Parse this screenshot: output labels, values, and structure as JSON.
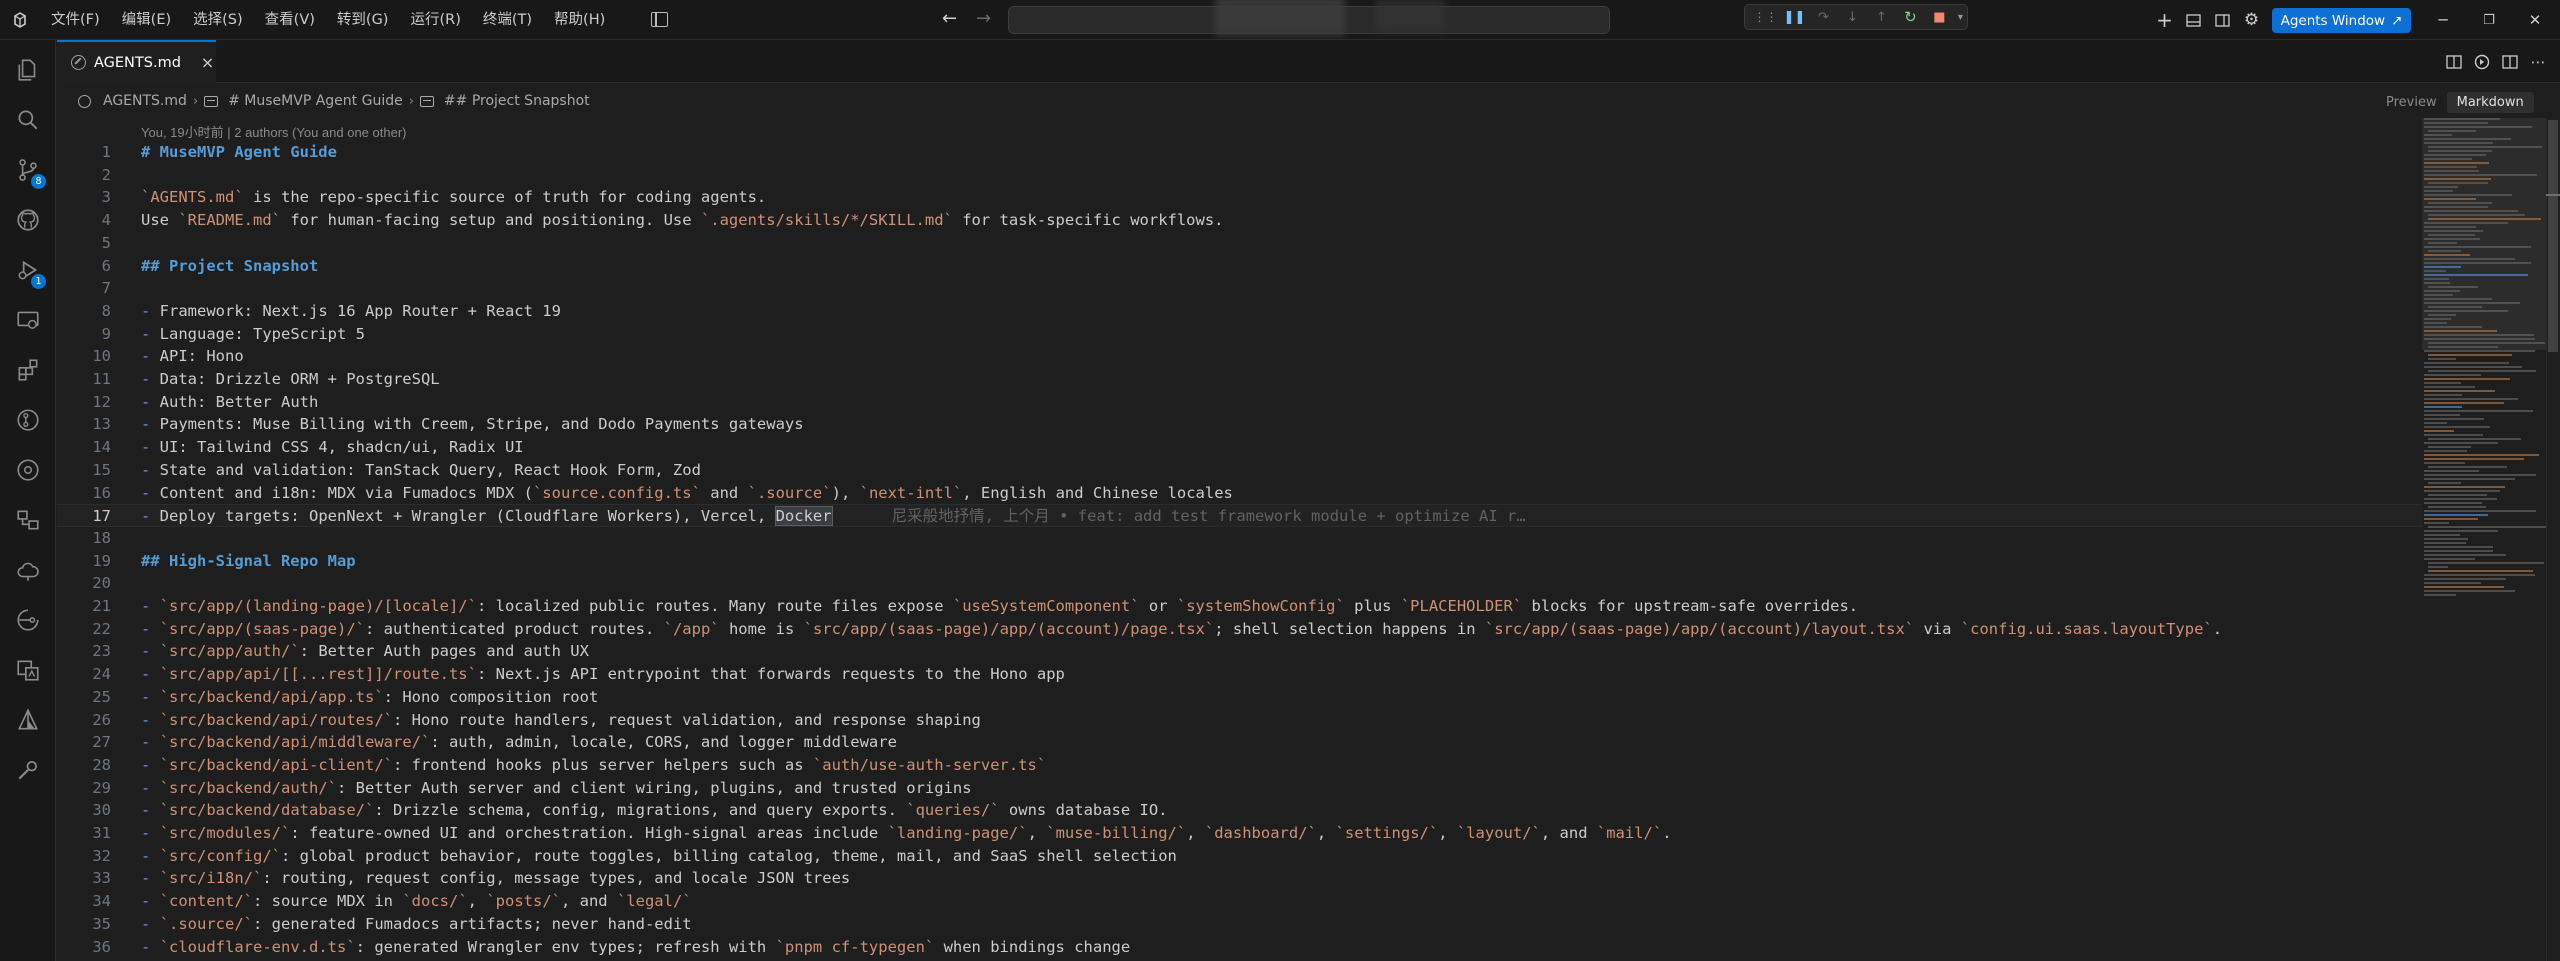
{
  "titlebar": {
    "menu": [
      "文件(F)",
      "编辑(E)",
      "选择(S)",
      "查看(V)",
      "转到(G)",
      "运行(R)",
      "终端(T)",
      "帮助(H)"
    ],
    "agents_button": "Agents Window"
  },
  "activity": {
    "scm_badge": "8",
    "debug_badge": "1"
  },
  "tab": {
    "label": "AGENTS.md",
    "close": "×"
  },
  "breadcrumb": {
    "file": "AGENTS.md",
    "heading1": "# MuseMVP Agent Guide",
    "heading2": "## Project Snapshot"
  },
  "view_switch": {
    "preview": "Preview",
    "markdown": "Markdown"
  },
  "blame": "You, 19小时前 | 2 authors (You and one other)",
  "inline_blame": "尼采般地抒情, 上个月 • feat: add test framework module + optimize AI r…",
  "editor_lines": [
    {
      "n": "1",
      "parts": [
        {
          "t": "# MuseMVP Agent Guide",
          "c": "h"
        }
      ]
    },
    {
      "n": "2",
      "parts": []
    },
    {
      "n": "3",
      "parts": [
        {
          "t": "`AGENTS.md`",
          "c": "c"
        },
        {
          "t": " is the repo-specific source of truth for coding agents.",
          "c": ""
        }
      ]
    },
    {
      "n": "4",
      "parts": [
        {
          "t": "Use ",
          "c": ""
        },
        {
          "t": "`README.md`",
          "c": "c"
        },
        {
          "t": " for human-facing setup and positioning. Use ",
          "c": ""
        },
        {
          "t": "`.agents/skills/*/SKILL.md`",
          "c": "c"
        },
        {
          "t": " for task-specific workflows.",
          "c": ""
        }
      ]
    },
    {
      "n": "5",
      "parts": []
    },
    {
      "n": "6",
      "parts": [
        {
          "t": "## Project Snapshot",
          "c": "h"
        }
      ]
    },
    {
      "n": "7",
      "parts": []
    },
    {
      "n": "8",
      "parts": [
        {
          "t": "-",
          "c": "p"
        },
        {
          "t": " Framework: Next.js 16 App Router + React 19",
          "c": ""
        }
      ]
    },
    {
      "n": "9",
      "parts": [
        {
          "t": "-",
          "c": "p"
        },
        {
          "t": " Language: TypeScript 5",
          "c": ""
        }
      ]
    },
    {
      "n": "10",
      "parts": [
        {
          "t": "-",
          "c": "p"
        },
        {
          "t": " API: Hono",
          "c": ""
        }
      ]
    },
    {
      "n": "11",
      "parts": [
        {
          "t": "-",
          "c": "p"
        },
        {
          "t": " Data: Drizzle ORM + PostgreSQL",
          "c": ""
        }
      ]
    },
    {
      "n": "12",
      "parts": [
        {
          "t": "-",
          "c": "p"
        },
        {
          "t": " Auth: Better Auth",
          "c": ""
        }
      ]
    },
    {
      "n": "13",
      "parts": [
        {
          "t": "-",
          "c": "p"
        },
        {
          "t": " Payments: Muse Billing with Creem, Stripe, and Dodo Payments gateways",
          "c": ""
        }
      ]
    },
    {
      "n": "14",
      "parts": [
        {
          "t": "-",
          "c": "p"
        },
        {
          "t": " UI: Tailwind CSS 4, shadcn/ui, Radix UI",
          "c": ""
        }
      ]
    },
    {
      "n": "15",
      "parts": [
        {
          "t": "-",
          "c": "p"
        },
        {
          "t": " State and validation: TanStack Query, React Hook Form, Zod",
          "c": ""
        }
      ]
    },
    {
      "n": "16",
      "parts": [
        {
          "t": "-",
          "c": "p"
        },
        {
          "t": " Content and i18n: MDX via Fumadocs MDX (",
          "c": ""
        },
        {
          "t": "`source.config.ts`",
          "c": "c"
        },
        {
          "t": " and ",
          "c": ""
        },
        {
          "t": "`.source`",
          "c": "c"
        },
        {
          "t": "), ",
          "c": ""
        },
        {
          "t": "`next-intl`",
          "c": "c"
        },
        {
          "t": ", English and Chinese locales",
          "c": ""
        }
      ]
    },
    {
      "n": "17",
      "parts": [
        {
          "t": "-",
          "c": "p"
        },
        {
          "t": " Deploy targets: OpenNext + Wrangler (Cloudflare Workers), Vercel, ",
          "c": ""
        },
        {
          "t": "Docker",
          "c": "sel"
        }
      ],
      "current": true
    },
    {
      "n": "18",
      "parts": []
    },
    {
      "n": "19",
      "parts": [
        {
          "t": "## High-Signal Repo Map",
          "c": "h"
        }
      ]
    },
    {
      "n": "20",
      "parts": []
    },
    {
      "n": "21",
      "parts": [
        {
          "t": "-",
          "c": "p"
        },
        {
          "t": " ",
          "c": ""
        },
        {
          "t": "`src/app/(landing-page)/[locale]/`",
          "c": "c"
        },
        {
          "t": ": localized public routes. Many route files expose ",
          "c": ""
        },
        {
          "t": "`useSystemComponent`",
          "c": "c"
        },
        {
          "t": " or ",
          "c": ""
        },
        {
          "t": "`systemShowConfig`",
          "c": "c"
        },
        {
          "t": " plus ",
          "c": ""
        },
        {
          "t": "`PLACEHOLDER`",
          "c": "c"
        },
        {
          "t": " blocks for upstream-safe overrides.",
          "c": ""
        }
      ]
    },
    {
      "n": "22",
      "parts": [
        {
          "t": "-",
          "c": "p"
        },
        {
          "t": " ",
          "c": ""
        },
        {
          "t": "`src/app/(saas-page)/`",
          "c": "c"
        },
        {
          "t": ": authenticated product routes. ",
          "c": ""
        },
        {
          "t": "`/app`",
          "c": "c"
        },
        {
          "t": " home is ",
          "c": ""
        },
        {
          "t": "`src/app/(saas-page)/app/(account)/page.tsx`",
          "c": "c"
        },
        {
          "t": "; shell selection happens in ",
          "c": ""
        },
        {
          "t": "`src/app/(saas-page)/app/(account)/layout.tsx`",
          "c": "c"
        },
        {
          "t": " via ",
          "c": ""
        },
        {
          "t": "`config.ui.saas.layoutType`",
          "c": "c"
        },
        {
          "t": ".",
          "c": ""
        }
      ]
    },
    {
      "n": "23",
      "parts": [
        {
          "t": "-",
          "c": "p"
        },
        {
          "t": " ",
          "c": ""
        },
        {
          "t": "`src/app/auth/`",
          "c": "c"
        },
        {
          "t": ": Better Auth pages and auth UX",
          "c": ""
        }
      ]
    },
    {
      "n": "24",
      "parts": [
        {
          "t": "-",
          "c": "p"
        },
        {
          "t": " ",
          "c": ""
        },
        {
          "t": "`src/app/api/[[...rest]]/route.ts`",
          "c": "c"
        },
        {
          "t": ": Next.js API entrypoint that forwards requests to the Hono app",
          "c": ""
        }
      ]
    },
    {
      "n": "25",
      "parts": [
        {
          "t": "-",
          "c": "p"
        },
        {
          "t": " ",
          "c": ""
        },
        {
          "t": "`src/backend/api/app.ts`",
          "c": "c"
        },
        {
          "t": ": Hono composition root",
          "c": ""
        }
      ]
    },
    {
      "n": "26",
      "parts": [
        {
          "t": "-",
          "c": "p"
        },
        {
          "t": " ",
          "c": ""
        },
        {
          "t": "`src/backend/api/routes/`",
          "c": "c"
        },
        {
          "t": ": Hono route handlers, request validation, and response shaping",
          "c": ""
        }
      ]
    },
    {
      "n": "27",
      "parts": [
        {
          "t": "-",
          "c": "p"
        },
        {
          "t": " ",
          "c": ""
        },
        {
          "t": "`src/backend/api/middleware/`",
          "c": "c"
        },
        {
          "t": ": auth, admin, locale, CORS, and logger middleware",
          "c": ""
        }
      ]
    },
    {
      "n": "28",
      "parts": [
        {
          "t": "-",
          "c": "p"
        },
        {
          "t": " ",
          "c": ""
        },
        {
          "t": "`src/backend/api-client/`",
          "c": "c"
        },
        {
          "t": ": frontend hooks plus server helpers such as ",
          "c": ""
        },
        {
          "t": "`auth/use-auth-server.ts`",
          "c": "c"
        }
      ]
    },
    {
      "n": "29",
      "parts": [
        {
          "t": "-",
          "c": "p"
        },
        {
          "t": " ",
          "c": ""
        },
        {
          "t": "`src/backend/auth/`",
          "c": "c"
        },
        {
          "t": ": Better Auth server and client wiring, plugins, and trusted origins",
          "c": ""
        }
      ]
    },
    {
      "n": "30",
      "parts": [
        {
          "t": "-",
          "c": "p"
        },
        {
          "t": " ",
          "c": ""
        },
        {
          "t": "`src/backend/database/`",
          "c": "c"
        },
        {
          "t": ": Drizzle schema, config, migrations, and query exports. ",
          "c": ""
        },
        {
          "t": "`queries/`",
          "c": "c"
        },
        {
          "t": " owns database IO.",
          "c": ""
        }
      ]
    },
    {
      "n": "31",
      "parts": [
        {
          "t": "-",
          "c": "p"
        },
        {
          "t": " ",
          "c": ""
        },
        {
          "t": "`src/modules/`",
          "c": "c"
        },
        {
          "t": ": feature-owned UI and orchestration. High-signal areas include ",
          "c": ""
        },
        {
          "t": "`landing-page/`",
          "c": "c"
        },
        {
          "t": ", ",
          "c": ""
        },
        {
          "t": "`muse-billing/`",
          "c": "c"
        },
        {
          "t": ", ",
          "c": ""
        },
        {
          "t": "`dashboard/`",
          "c": "c"
        },
        {
          "t": ", ",
          "c": ""
        },
        {
          "t": "`settings/`",
          "c": "c"
        },
        {
          "t": ", ",
          "c": ""
        },
        {
          "t": "`layout/`",
          "c": "c"
        },
        {
          "t": ", and ",
          "c": ""
        },
        {
          "t": "`mail/`",
          "c": "c"
        },
        {
          "t": ".",
          "c": ""
        }
      ]
    },
    {
      "n": "32",
      "parts": [
        {
          "t": "-",
          "c": "p"
        },
        {
          "t": " ",
          "c": ""
        },
        {
          "t": "`src/config/`",
          "c": "c"
        },
        {
          "t": ": global product behavior, route toggles, billing catalog, theme, mail, and SaaS shell selection",
          "c": ""
        }
      ]
    },
    {
      "n": "33",
      "parts": [
        {
          "t": "-",
          "c": "p"
        },
        {
          "t": " ",
          "c": ""
        },
        {
          "t": "`src/i18n/`",
          "c": "c"
        },
        {
          "t": ": routing, request config, message types, and locale JSON trees",
          "c": ""
        }
      ]
    },
    {
      "n": "34",
      "parts": [
        {
          "t": "-",
          "c": "p"
        },
        {
          "t": " ",
          "c": ""
        },
        {
          "t": "`content/`",
          "c": "c"
        },
        {
          "t": ": source MDX in ",
          "c": ""
        },
        {
          "t": "`docs/`",
          "c": "c"
        },
        {
          "t": ", ",
          "c": ""
        },
        {
          "t": "`posts/`",
          "c": "c"
        },
        {
          "t": ", and ",
          "c": ""
        },
        {
          "t": "`legal/`",
          "c": "c"
        }
      ]
    },
    {
      "n": "35",
      "parts": [
        {
          "t": "-",
          "c": "p"
        },
        {
          "t": " ",
          "c": ""
        },
        {
          "t": "`.source/`",
          "c": "c"
        },
        {
          "t": ": generated Fumadocs artifacts; never hand-edit",
          "c": ""
        }
      ]
    },
    {
      "n": "36",
      "parts": [
        {
          "t": "-",
          "c": "p"
        },
        {
          "t": " ",
          "c": ""
        },
        {
          "t": "`cloudflare-env.d.ts`",
          "c": "c"
        },
        {
          "t": ": generated Wrangler env types; refresh with ",
          "c": ""
        },
        {
          "t": "`pnpm cf-typegen`",
          "c": "c"
        },
        {
          "t": " when bindings change",
          "c": ""
        }
      ]
    }
  ]
}
